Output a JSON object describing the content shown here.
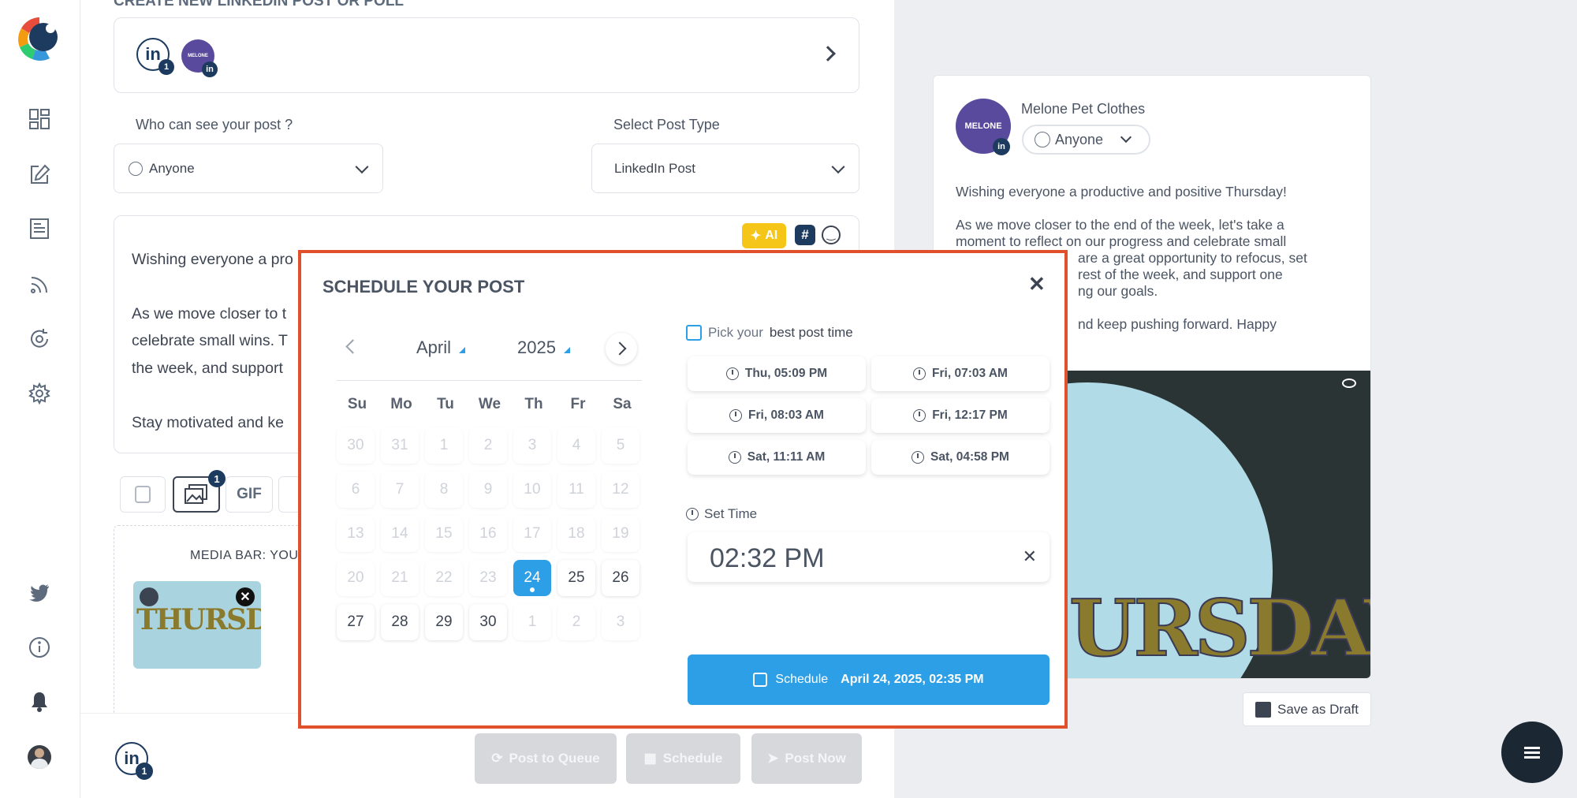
{
  "sidebar": {
    "items": [
      "dashboard-icon",
      "compose-icon",
      "posts-icon",
      "feed-icon",
      "queue-icon",
      "settings-icon"
    ],
    "bottom": [
      "twitter-icon",
      "info-icon",
      "bell-icon",
      "user-avatar"
    ]
  },
  "editor": {
    "page_heading": "CREATE NEW LINKEDIN POST OR POLL",
    "accounts_badge": "1",
    "account_logo_text": "MELONE",
    "visibility_label": "Who can see your post ?",
    "visibility_value": "Anyone",
    "post_type_label": "Select Post Type",
    "post_type_value": "LinkedIn Post",
    "ai_label": "AI",
    "text_lines": [
      "Wishing everyone a pro",
      "As we move closer to t",
      "celebrate small wins. T",
      "the week, and support",
      "Stay motivated and ke"
    ],
    "media_badge": "1",
    "gif_label": "GIF",
    "media_bar_label": "MEDIA BAR: YOU",
    "thumb_text": "THURSDAY",
    "bottom_badge": "1",
    "post_to_queue": "Post to Queue",
    "schedule": "Schedule",
    "post_now": "Post Now"
  },
  "preview": {
    "account_name": "Melone Pet Clothes",
    "avatar_text": "MELONE",
    "visibility": "Anyone",
    "lines": [
      "Wishing everyone a productive and positive Thursday!",
      "",
      "As we move closer to the end of the week, let's take a",
      "moment to reflect on our progress and celebrate small",
      "are a great opportunity to refocus, set",
      "rest of the week, and support one",
      "ng our goals.",
      "",
      "nd keep pushing forward. Happy"
    ],
    "image_text": "URSDAY",
    "save_draft": "Save as Draft"
  },
  "modal": {
    "title": "SCHEDULE YOUR POST",
    "month": "April",
    "year": "2025",
    "weekdays": [
      "Su",
      "Mo",
      "Tu",
      "We",
      "Th",
      "Fr",
      "Sa"
    ],
    "weeks": [
      [
        "30",
        "31",
        "1",
        "2",
        "3",
        "4",
        "5"
      ],
      [
        "6",
        "7",
        "8",
        "9",
        "10",
        "11",
        "12"
      ],
      [
        "13",
        "14",
        "15",
        "16",
        "17",
        "18",
        "19"
      ],
      [
        "20",
        "21",
        "22",
        "23",
        "24",
        "25",
        "26"
      ],
      [
        "27",
        "28",
        "29",
        "30",
        "1",
        "2",
        "3"
      ]
    ],
    "selected_day": "24",
    "pick_label": "Pick your",
    "pick_bold": "best post time",
    "best_times": [
      "Thu, 05:09 PM",
      "Fri, 07:03 AM",
      "Fri, 08:03 AM",
      "Fri, 12:17 PM",
      "Sat, 11:11 AM",
      "Sat, 04:58 PM"
    ],
    "set_time_label": "Set Time",
    "time_value": "02:32 PM",
    "schedule_label": "Schedule",
    "schedule_datetime": "April 24, 2025, 02:35 PM"
  },
  "colors": {
    "accent": "#2d9fe6",
    "modal_border": "#e0502a",
    "ai_yellow": "#f5c518",
    "linkedin_navy": "#1d3b5f",
    "avatar_purple": "#5a4a9e"
  }
}
